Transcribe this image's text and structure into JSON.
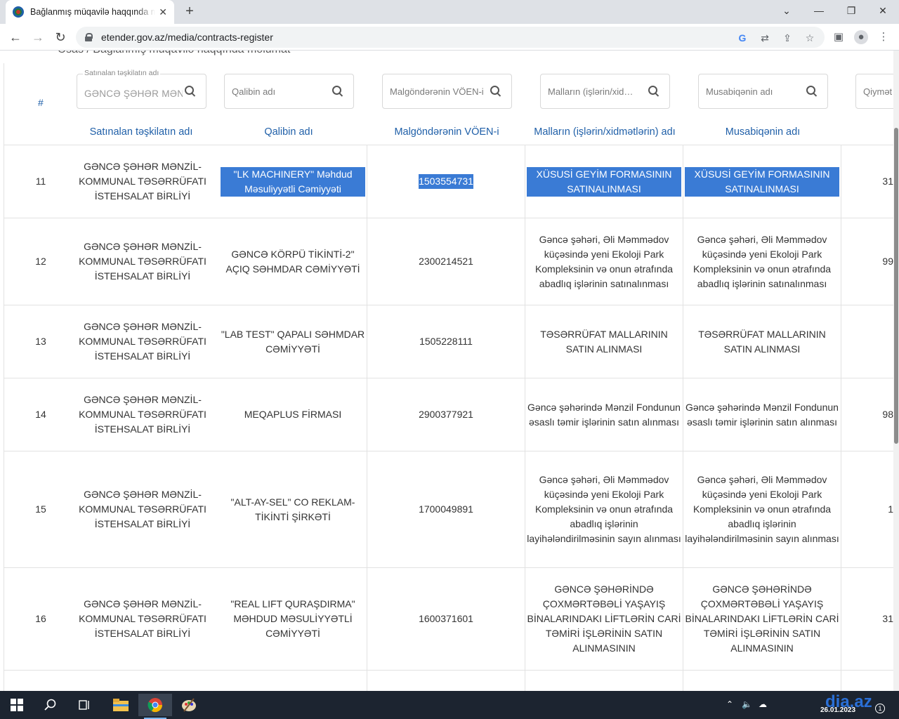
{
  "browser": {
    "tab_title": "Bağlanmış müqavilə haqqında məlumat",
    "tab_close": "✕",
    "new_tab": "+",
    "url": "etender.gov.az/media/contracts-register",
    "window_controls": {
      "minimize": "⌄",
      "minimize2": "—",
      "restore": "❐",
      "close": "✕"
    },
    "nav": {
      "back": "←",
      "forward": "→",
      "reload": "↻"
    }
  },
  "page": {
    "breadcrumb": "Əsas / Bağlanmış müqavilə haqqında məlumat"
  },
  "table": {
    "hash_header": "#",
    "filters": [
      {
        "float_label": "Satınalan təşkilatın adı",
        "value": "GƏNCƏ ŞƏHƏR MƏNZİL",
        "placeholder": ""
      },
      {
        "float_label": "",
        "value": "",
        "placeholder": "Qalibin adı"
      },
      {
        "float_label": "",
        "value": "",
        "placeholder": "Malgöndərənin VÖEN-i"
      },
      {
        "float_label": "",
        "value": "",
        "placeholder": "Malların (işlərin/xidmətlərin) adı"
      },
      {
        "float_label": "",
        "value": "",
        "placeholder": "Musabiqənin adı"
      },
      {
        "float_label": "",
        "value": "",
        "placeholder": "Qiymət"
      }
    ],
    "columns": [
      "Satınalan təşkilatın adı",
      "Qalibin adı",
      "Malgöndərənin VÖEN-i",
      "Malların (işlərin/xidmətlərin) adı",
      "Musabiqənin adı"
    ],
    "rows": [
      {
        "num": "11",
        "org": "GƏNCƏ ŞƏHƏR MƏNZİL-KOMMUNAL TƏSƏRRÜFATI İSTEHSALAT BİRLİYİ",
        "winner": "\"LK MACHINERY\" Məhdud Məsuliyyətli Cəmiyyəti",
        "voen": "1503554731",
        "goods": "XÜSUSİ GEYİM FORMASININ SATINALINMASI",
        "contest": "XÜSUSİ GEYİM FORMASININ SATINALINMASI",
        "price": "31"
      },
      {
        "num": "12",
        "org": "GƏNCƏ ŞƏHƏR MƏNZİL-KOMMUNAL TƏSƏRRÜFATI İSTEHSALAT BİRLİYİ",
        "winner": "GƏNCƏ KÖRPÜ TİKİNTİ-2\" AÇIQ SƏHMDAR CƏMİYYƏTİ",
        "voen": "2300214521",
        "goods": "Gəncə şəhəri, Əli Məmmədov küçəsində yeni Ekoloji Park Kompleksinin və onun ətrafında abadlıq işlərinin satınalınması",
        "contest": "Gəncə şəhəri, Əli Məmmədov küçəsində yeni Ekoloji Park Kompleksinin və onun ətrafında abadlıq işlərinin satınalınması",
        "price": "99"
      },
      {
        "num": "13",
        "org": "GƏNCƏ ŞƏHƏR MƏNZİL-KOMMUNAL TƏSƏRRÜFATI İSTEHSALAT BİRLİYİ",
        "winner": "\"LAB TEST\" QAPALI SƏHMDAR CƏMİYYƏTİ",
        "voen": "1505228111",
        "goods": "TƏSƏRRÜFAT MALLARININ SATIN ALINMASI",
        "contest": "TƏSƏRRÜFAT MALLARININ SATIN ALINMASI",
        "price": ""
      },
      {
        "num": "14",
        "org": "GƏNCƏ ŞƏHƏR MƏNZİL-KOMMUNAL TƏSƏRRÜFATI İSTEHSALAT BİRLİYİ",
        "winner": "MEQAPLUS FİRMASI",
        "voen": "2900377921",
        "goods": "Gəncə şəhərində Mənzil Fondunun əsaslı təmir işlərinin satın alınması",
        "contest": "Gəncə şəhərində Mənzil Fondunun əsaslı təmir işlərinin satın alınması",
        "price": "98"
      },
      {
        "num": "15",
        "org": "GƏNCƏ ŞƏHƏR MƏNZİL-KOMMUNAL TƏSƏRRÜFATI İSTEHSALAT BİRLİYİ",
        "winner": "\"ALT-AY-SEL\" CO REKLAM-TİKİNTİ ŞİRKƏTİ",
        "voen": "1700049891",
        "goods": "Gəncə şəhəri, Əli Məmmədov küçəsində yeni Ekoloji Park Kompleksinin və onun ətrafında abadlıq işlərinin layihələndirilməsinin sayın alınması",
        "contest": "Gəncə şəhəri, Əli Məmmədov küçəsində yeni Ekoloji Park Kompleksinin və onun ətrafında abadlıq işlərinin layihələndirilməsinin sayın alınması",
        "price": "1"
      },
      {
        "num": "16",
        "org": "GƏNCƏ ŞƏHƏR MƏNZİL-KOMMUNAL TƏSƏRRÜFATI İSTEHSALAT BİRLİYİ",
        "winner": "\"REAL LIFT QURAŞDIRMA\" MƏHDUD MƏSULİYYƏTLİ CƏMİYYƏTİ",
        "voen": "1600371601",
        "goods": "GƏNCƏ ŞƏHƏRİNDƏ ÇOXMƏRTƏBƏLİ YAŞAYIŞ BİNALARINDAKI LİFTLƏRİN CARİ TƏMİRİ İŞLƏRİNİN SATIN ALINMASININ",
        "contest": "GƏNCƏ ŞƏHƏRİNDƏ ÇOXMƏRTƏBƏLİ YAŞAYIŞ BİNALARINDAKI LİFTLƏRİN CARİ TƏMİRİ İŞLƏRİNİN SATIN ALINMASININ",
        "price": "31"
      }
    ]
  },
  "taskbar": {
    "date": "26.01.2023",
    "watermark": "dia.az"
  }
}
